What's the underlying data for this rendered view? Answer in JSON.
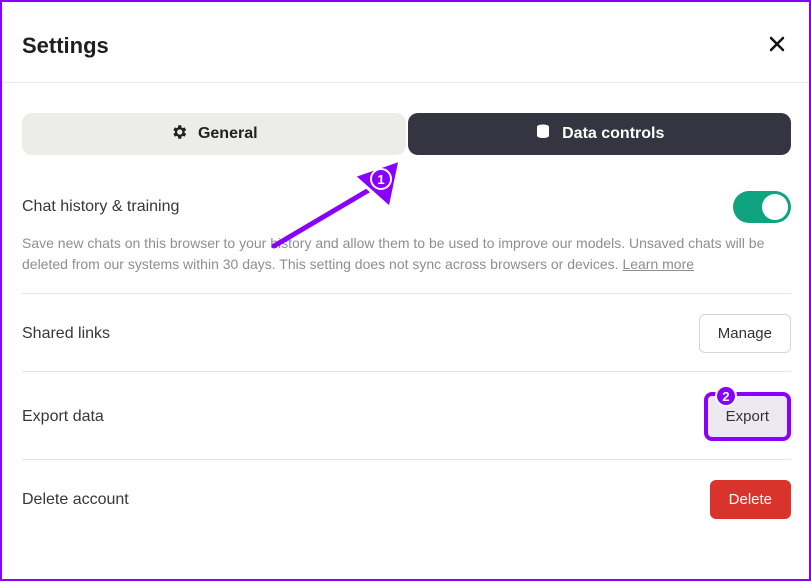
{
  "title": "Settings",
  "tabs": {
    "general": "General",
    "data": "Data controls"
  },
  "sections": {
    "history": {
      "title": "Chat history & training",
      "desc_pre": "Save new chats on this browser to your history and allow them to be used to improve our models. Unsaved chats will be deleted from our systems within 30 days. This setting does not sync across browsers or devices. ",
      "learn_more": "Learn more"
    },
    "shared": {
      "title": "Shared links",
      "button": "Manage"
    },
    "export": {
      "title": "Export data",
      "button": "Export"
    },
    "delete": {
      "title": "Delete account",
      "button": "Delete"
    }
  },
  "annotations": {
    "badge1": "1",
    "badge2": "2"
  }
}
